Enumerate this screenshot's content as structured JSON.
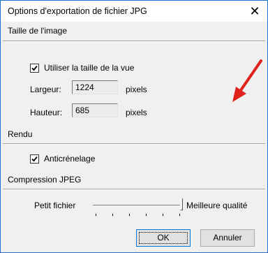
{
  "window": {
    "title": "Options d'exportation de fichier JPG",
    "close_glyph": "✕"
  },
  "image_size": {
    "heading": "Taille de l'image",
    "use_view_size_label": "Utiliser la taille de la vue",
    "use_view_size_checked": true,
    "width_label": "Largeur:",
    "width_value": "1224",
    "width_unit": "pixels",
    "height_label": "Hauteur:",
    "height_value": "685",
    "height_unit": "pixels"
  },
  "render": {
    "heading": "Rendu",
    "antialias_label": "Anticrénelage",
    "antialias_checked": true
  },
  "jpeg_compression": {
    "heading": "Compression JPEG",
    "small_file_label": "Petit fichier",
    "best_quality_label": "Meilleure qualité",
    "quality_level_fraction": 1.0,
    "tick_count": 6
  },
  "buttons": {
    "ok_label": "OK",
    "cancel_label": "Annuler"
  },
  "annotation": {
    "arrow_color": "#e0221c",
    "arrow_icon": "red-arrow-icon"
  },
  "colors": {
    "dialog_border": "#1e6fd0",
    "dialog_background": "#f0f0f0",
    "default_button_border": "#0078d7"
  }
}
